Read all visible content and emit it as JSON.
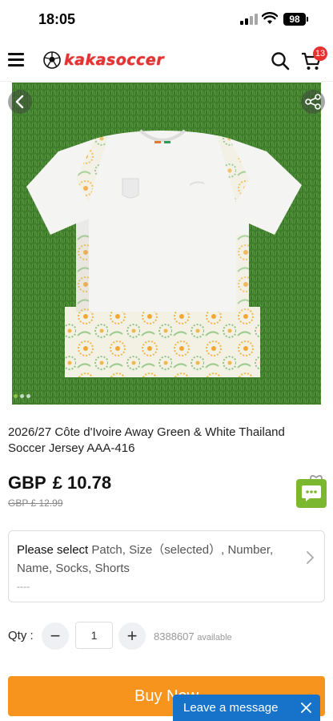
{
  "status_bar": {
    "time": "18:05",
    "battery": "98"
  },
  "header": {
    "logo_text": "kakasoccer",
    "cart_count": "13",
    "icons": [
      "menu-icon",
      "soccer-ball-icon",
      "search-icon",
      "cart-icon"
    ]
  },
  "product": {
    "image_description_icon": "jersey-photo",
    "gallery_total": 3,
    "gallery_active": 1,
    "title": "2026/27 Côte d'Ivoire Away Green & White Thailand Soccer Jersey AAA-416",
    "currency": "GBP",
    "price": "£ 10.78",
    "old_price": "GBP £ 12.99"
  },
  "options": {
    "lead": "Please select",
    "items": "Patch, Size（selected）, Number, Name, Socks, Shorts",
    "sub": "----"
  },
  "qty": {
    "label": "Qty :",
    "value": "1",
    "minus": "−",
    "plus": "+",
    "available_count": "8388607",
    "available_label": "available"
  },
  "actions": {
    "buy_now": "Buy Now",
    "leave_message": "Leave a message"
  },
  "colors": {
    "accent_orange": "#f7941d",
    "brand_red": "#e53333",
    "message_blue": "#1673c9",
    "chat_green": "#7cb82f"
  }
}
